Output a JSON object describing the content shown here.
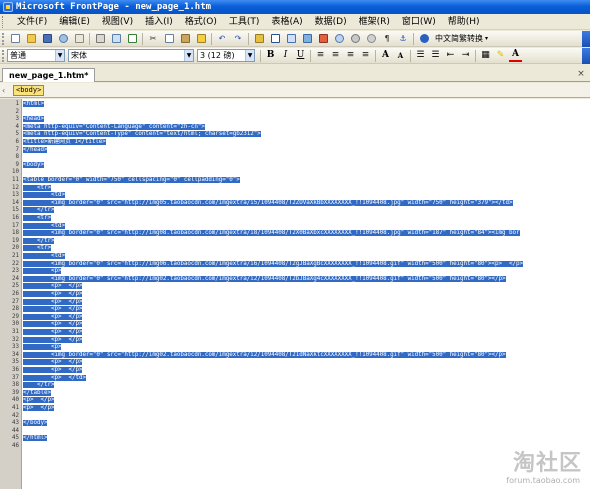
{
  "window": {
    "title": "Microsoft FrontPage - new_page_1.htm"
  },
  "menu": [
    "文件(F)",
    "编辑(E)",
    "视图(V)",
    "插入(I)",
    "格式(O)",
    "工具(T)",
    "表格(A)",
    "数据(D)",
    "框架(R)",
    "窗口(W)",
    "帮助(H)"
  ],
  "toolbar": {
    "translate_label": "中文简繁转换",
    "style_value": "普通",
    "font_value": "宋体",
    "size_value": "3 (12 磅)"
  },
  "tab": {
    "label": "new_page_1.htm*"
  },
  "quicktag": {
    "tag": "<body>"
  },
  "code_lines": [
    "<html>",
    "",
    "<head>",
    "<meta http-equiv=\"Content-Language\" content=\"zh-cn\">",
    "<meta http-equiv=\"Content-Type\" content=\"text/html; charset=gb2312\">",
    "<title>新建网页 1</title>",
    "</head>",
    "",
    "<body>",
    "",
    "<table border=\"0\" width=\"750\" cellspacing=\"0\" cellpadding=\"0\">",
    "    <tr>",
    "        <td>",
    "        <img border=\"0\" src=\"http://img05.taobaocdn.com/imgextra/i5/1094408/T2ZOVaXkBbXXXXXXXX_!!1094408.jpg\" width=\"750\" height=\"379\"></td>",
    "    </tr>",
    "    <tr>",
    "        <td>",
    "        <img border=\"0\" src=\"http://img08.taobaocdn.com/imgextra/i8/1094408/T2X0BaXbxcXXXXXXXX_!!1094408.jpg\" width=\"187\" height=\"84\"><img bor",
    "    </tr>",
    "    <tr>",
    "        <td>",
    "        <img border=\"0\" src=\"http://img06.taobaocdn.com/imgextra/i6/1094408/T2gJBaXgBcXXXXXXXX_!!1094408.gif\" width=\"500\" height=\"80\"><p>  </p>",
    "        <p>",
    "        <img border=\"0\" src=\"http://img02.taobaocdn.com/imgextra/i2/1094408/T2bJBaXg4cXXXXXXXX_!!1094408.gif\" width=\"500\" height=\"80\"></p>",
    "        <p>  </p>",
    "        <p>  </p>",
    "        <p>  </p>",
    "        <p>  </p>",
    "        <p>  </p>",
    "        <p>  </p>",
    "        <p>  </p>",
    "        <p>  </p>",
    "        <p>",
    "        <img border=\"0\" src=\"http://img02.taobaocdn.com/imgextra/i2/1094408/T21dNaXktcXXXXXXXX_!!1094408.gif\" width=\"500\" height=\"80\"></p>",
    "        <p>  </p>",
    "        <p>  </p>",
    "        <p>  </td>",
    "    </tr>",
    "</table>",
    "<p>  </p>",
    "<p>  </p>",
    "",
    "</body>",
    "",
    "</html>",
    ""
  ],
  "line_numbers": [
    "1",
    "2",
    "3",
    "4",
    "5",
    "6",
    "7",
    "8",
    "9",
    "10",
    "11",
    "12",
    "13",
    "14",
    "15",
    "16",
    "17",
    "18",
    "19",
    "20",
    "21",
    "22",
    "23",
    "24",
    "25",
    "26",
    "27",
    "28",
    "29",
    "30",
    "31",
    "32",
    "33",
    "34",
    "35",
    "36",
    "37",
    "38",
    "39",
    "40",
    "41",
    "42",
    "43",
    "44",
    "45",
    "46"
  ],
  "watermark": {
    "main": "淘社区",
    "sub": "forum.taobao.com"
  }
}
